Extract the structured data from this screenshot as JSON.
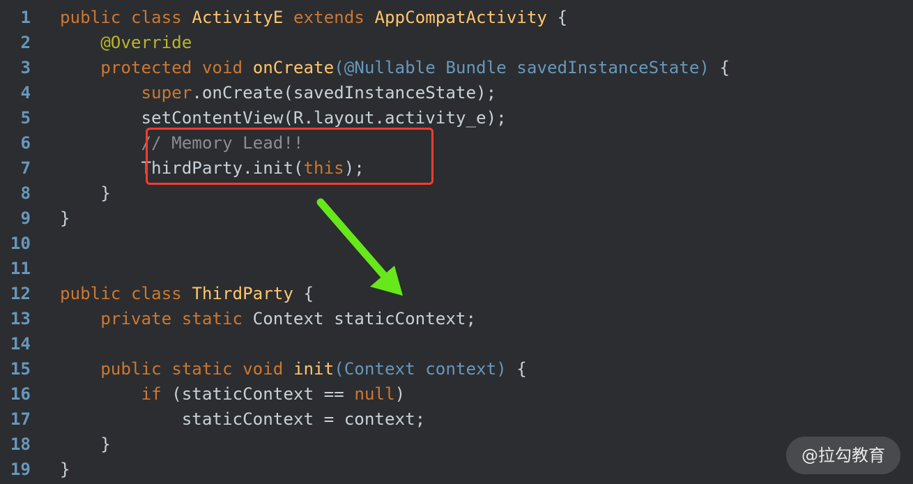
{
  "lines": [
    {
      "number": "1",
      "tokens": [
        {
          "text": "public",
          "type": "kw"
        },
        {
          "text": " ",
          "type": "plain"
        },
        {
          "text": "class",
          "type": "kw"
        },
        {
          "text": " ",
          "type": "plain"
        },
        {
          "text": "ActivityE",
          "type": "cls"
        },
        {
          "text": " ",
          "type": "plain"
        },
        {
          "text": "extends",
          "type": "kw"
        },
        {
          "text": " ",
          "type": "plain"
        },
        {
          "text": "AppCompatActivity",
          "type": "cls"
        },
        {
          "text": " {",
          "type": "plain"
        }
      ]
    },
    {
      "number": "2",
      "tokens": [
        {
          "text": "    ",
          "type": "plain"
        },
        {
          "text": "@Override",
          "type": "ann"
        }
      ]
    },
    {
      "number": "3",
      "tokens": [
        {
          "text": "    ",
          "type": "plain"
        },
        {
          "text": "protected",
          "type": "kw"
        },
        {
          "text": " ",
          "type": "plain"
        },
        {
          "text": "void",
          "type": "kw"
        },
        {
          "text": " ",
          "type": "plain"
        },
        {
          "text": "onCreate",
          "type": "cls"
        },
        {
          "text": "(@Nullable Bundle savedInstanceState)",
          "type": "param"
        },
        {
          "text": " {",
          "type": "plain"
        }
      ]
    },
    {
      "number": "4",
      "tokens": [
        {
          "text": "        ",
          "type": "plain"
        },
        {
          "text": "super",
          "type": "kw"
        },
        {
          "text": ".onCreate(savedInstanceState);",
          "type": "plain"
        }
      ]
    },
    {
      "number": "5",
      "tokens": [
        {
          "text": "        ",
          "type": "plain"
        },
        {
          "text": "setContentView(R.layout.activity_e);",
          "type": "plain"
        }
      ]
    },
    {
      "number": "6",
      "tokens": [
        {
          "text": "        ",
          "type": "plain"
        },
        {
          "text": "// Memory Lead!!",
          "type": "cmt"
        }
      ]
    },
    {
      "number": "7",
      "tokens": [
        {
          "text": "        ",
          "type": "plain"
        },
        {
          "text": "ThirdParty.init(",
          "type": "plain"
        },
        {
          "text": "this",
          "type": "kw"
        },
        {
          "text": ");",
          "type": "plain"
        }
      ]
    },
    {
      "number": "8",
      "tokens": [
        {
          "text": "    }",
          "type": "plain"
        }
      ]
    },
    {
      "number": "9",
      "tokens": [
        {
          "text": "}",
          "type": "plain"
        }
      ]
    },
    {
      "number": "10",
      "tokens": []
    },
    {
      "number": "11",
      "tokens": []
    },
    {
      "number": "12",
      "tokens": [
        {
          "text": "public",
          "type": "kw"
        },
        {
          "text": " ",
          "type": "plain"
        },
        {
          "text": "class",
          "type": "kw"
        },
        {
          "text": " ",
          "type": "plain"
        },
        {
          "text": "ThirdParty",
          "type": "cls"
        },
        {
          "text": " {",
          "type": "plain"
        }
      ]
    },
    {
      "number": "13",
      "tokens": [
        {
          "text": "    ",
          "type": "plain"
        },
        {
          "text": "private",
          "type": "kw"
        },
        {
          "text": " ",
          "type": "plain"
        },
        {
          "text": "static",
          "type": "kw"
        },
        {
          "text": " Context staticContext;",
          "type": "plain"
        }
      ]
    },
    {
      "number": "14",
      "tokens": []
    },
    {
      "number": "15",
      "tokens": [
        {
          "text": "    ",
          "type": "plain"
        },
        {
          "text": "public",
          "type": "kw"
        },
        {
          "text": " ",
          "type": "plain"
        },
        {
          "text": "static",
          "type": "kw"
        },
        {
          "text": " ",
          "type": "plain"
        },
        {
          "text": "void",
          "type": "kw"
        },
        {
          "text": " ",
          "type": "plain"
        },
        {
          "text": "init",
          "type": "cls"
        },
        {
          "text": "(Context context)",
          "type": "param"
        },
        {
          "text": " {",
          "type": "plain"
        }
      ]
    },
    {
      "number": "16",
      "tokens": [
        {
          "text": "        ",
          "type": "plain"
        },
        {
          "text": "if",
          "type": "kw"
        },
        {
          "text": " (staticContext == ",
          "type": "plain"
        },
        {
          "text": "null",
          "type": "kw"
        },
        {
          "text": ")",
          "type": "plain"
        }
      ]
    },
    {
      "number": "17",
      "tokens": [
        {
          "text": "            staticContext = context;",
          "type": "plain"
        }
      ]
    },
    {
      "number": "18",
      "tokens": [
        {
          "text": "    }",
          "type": "plain"
        }
      ]
    },
    {
      "number": "19",
      "tokens": [
        {
          "text": "}",
          "type": "plain"
        }
      ]
    }
  ],
  "annotations": {
    "highlight_color": "#ff3b30",
    "arrow_color": "#66e81a"
  },
  "watermark": "@拉勾教育"
}
